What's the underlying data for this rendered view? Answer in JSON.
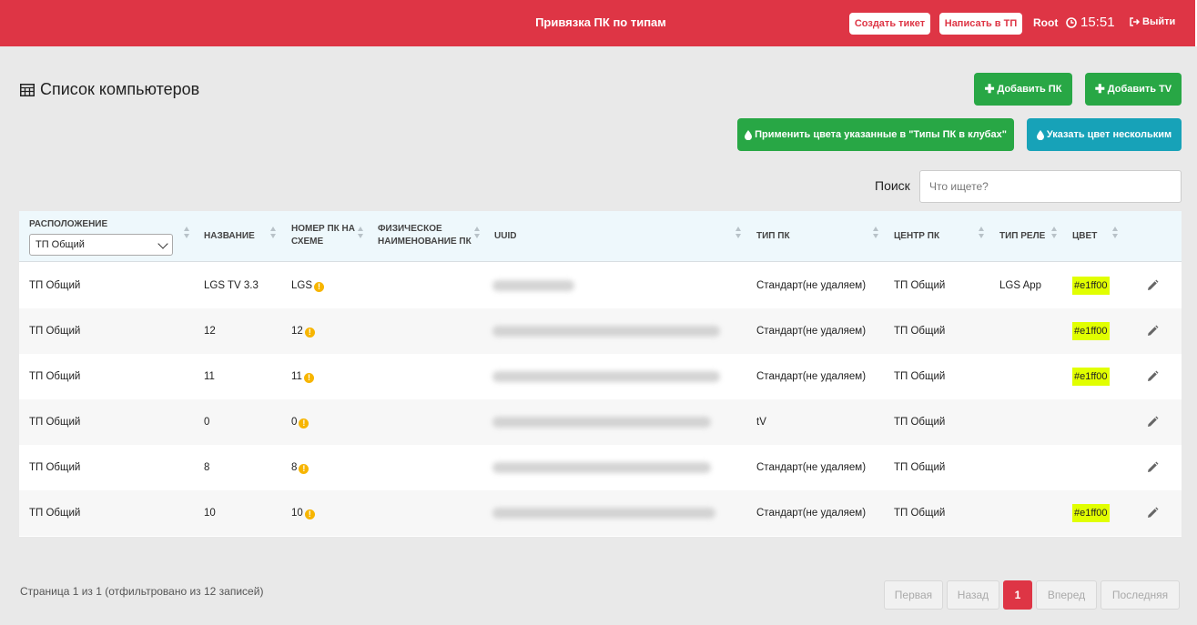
{
  "header": {
    "title": "Привязка ПК по типам",
    "create_ticket": "Создать тикет",
    "write_tp": "Написать в ТП",
    "user": "Root",
    "time": "15:51",
    "logout": "Выйти"
  },
  "page": {
    "title": "Список компьютеров",
    "add_pc": "Добавить ПК",
    "add_tv": "Добавить TV",
    "apply_colors": "Применить цвета указанные в \"Типы ПК в клубах\"",
    "set_color_many": "Указать цвет нескольким",
    "search_label": "Поиск",
    "search_placeholder": "Что ищете?"
  },
  "table": {
    "columns": {
      "location": "Расположение",
      "location_filter": "ТП Общий",
      "name": "Название",
      "scheme_line1": "Номер ПК на",
      "scheme_line2": "схеме",
      "phys_line1": "Физическое",
      "phys_line2": "наименование ПК",
      "uuid": "UUID",
      "type": "Тип ПК",
      "center": "Центр ПК",
      "relay": "Тип реле",
      "color": "Цвет"
    },
    "rows": [
      {
        "location": "ТП Общий",
        "name": "LGS TV 3.3",
        "scheme": "LGS",
        "type": "Стандарт(не удаляем)",
        "center": "ТП Общий",
        "relay": "LGS App",
        "color": "#e1ff00"
      },
      {
        "location": "ТП Общий",
        "name": "12",
        "scheme": "12",
        "type": "Стандарт(не удаляем)",
        "center": "ТП Общий",
        "relay": "",
        "color": "#e1ff00"
      },
      {
        "location": "ТП Общий",
        "name": "11",
        "scheme": "11",
        "type": "Стандарт(не удаляем)",
        "center": "ТП Общий",
        "relay": "",
        "color": "#e1ff00"
      },
      {
        "location": "ТП Общий",
        "name": "0",
        "scheme": "0",
        "type": "tV",
        "center": "ТП Общий",
        "relay": "",
        "color": ""
      },
      {
        "location": "ТП Общий",
        "name": "8",
        "scheme": "8",
        "type": "Стандарт(не удаляем)",
        "center": "ТП Общий",
        "relay": "",
        "color": ""
      },
      {
        "location": "ТП Общий",
        "name": "10",
        "scheme": "10",
        "type": "Стандарт(не удаляем)",
        "center": "ТП Общий",
        "relay": "",
        "color": "#e1ff00"
      }
    ]
  },
  "footer": {
    "info": "Страница 1 из 1 (отфильтровано из 12 записей)",
    "first": "Первая",
    "prev": "Назад",
    "current": "1",
    "next": "Вперед",
    "last": "Последняя"
  },
  "colors": {
    "brand_red": "#de3545",
    "green": "#28a745",
    "teal": "#17a2b8",
    "highlight": "#e1ff00"
  }
}
